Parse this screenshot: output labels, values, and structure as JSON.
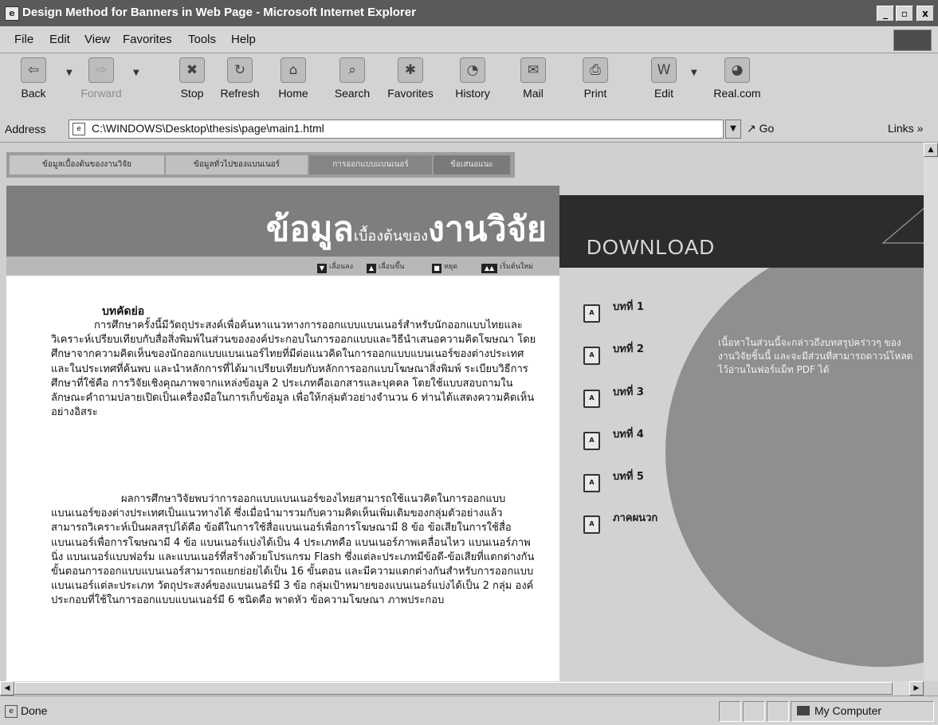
{
  "window": {
    "title": "Design Method for Banners in Web Page - Microsoft Internet Explorer",
    "controls": [
      "_",
      "▫",
      "x"
    ]
  },
  "menu": [
    "File",
    "Edit",
    "View",
    "Favorites",
    "Tools",
    "Help"
  ],
  "toolbar": {
    "buttons": [
      {
        "label": "Back",
        "icon": "back-arrow-icon",
        "glyph": "⇦",
        "enabled": true
      },
      {
        "label": "Forward",
        "icon": "forward-arrow-icon",
        "glyph": "⇨",
        "enabled": false
      },
      {
        "label": "Stop",
        "icon": "stop-icon",
        "glyph": "✖",
        "enabled": true
      },
      {
        "label": "Refresh",
        "icon": "refresh-icon",
        "glyph": "↻",
        "enabled": true
      },
      {
        "label": "Home",
        "icon": "home-icon",
        "glyph": "⌂",
        "enabled": true
      },
      {
        "label": "Search",
        "icon": "search-icon",
        "glyph": "⌕",
        "enabled": true
      },
      {
        "label": "Favorites",
        "icon": "favorites-icon",
        "glyph": "✱",
        "enabled": true
      },
      {
        "label": "History",
        "icon": "history-icon",
        "glyph": "◔",
        "enabled": true
      },
      {
        "label": "Mail",
        "icon": "mail-icon",
        "glyph": "✉",
        "enabled": true
      },
      {
        "label": "Print",
        "icon": "print-icon",
        "glyph": "⎙",
        "enabled": true
      },
      {
        "label": "Edit",
        "icon": "edit-icon",
        "glyph": "W",
        "enabled": true
      },
      {
        "label": "Real.com",
        "icon": "real-com-icon",
        "glyph": "◕",
        "enabled": true
      }
    ]
  },
  "address": {
    "label": "Address",
    "url": "C:\\WINDOWS\\Desktop\\thesis\\page\\main1.html",
    "go": "Go",
    "links": "Links »"
  },
  "page": {
    "nav_tabs": [
      "ข้อมูลเบื้องต้นของงานวิจัย",
      "ข้อมูลทั่วไปของแบนเนอร์",
      "การออกแบบแบนเนอร์",
      "ข้อเสนอแนะ"
    ],
    "banner": {
      "big": "ข้อมูล",
      "small": "เบื้องต้นของ",
      "big2": "งานวิจัย"
    },
    "controls": [
      "เลื่อนลง",
      "เลื่อนขึ้น",
      "หยุด",
      "เริ่มต้นใหม่"
    ],
    "abstract_heading": "บทคัดย่อ",
    "paragraph1": "การศึกษาครั้งนี้มีวัตถุประสงค์เพื่อค้นหาแนวทางการออกแบบแบนเนอร์สำหรับนักออกแบบไทยและวิเคราะห์เปรียบเทียบกับสื่อสิ่งพิมพ์ในส่วนขององค์ประกอบในการออกแบบและวิธีนำเสนอความคิดโฆษณา โดยศึกษาจากความคิดเห็นของนักออกแบบแบนเนอร์ไทยที่มีต่อแนวคิดในการออกแบบแบนเนอร์ของต่างประเทศและในประเทศที่ค้นพบ และนำหลักการที่ได้มาเปรียบเทียบกับหลักการออกแบบโฆษณาสิ่งพิมพ์ ระเบียบวิธีการศึกษาที่ใช้คือ การวิจัยเชิงคุณภาพจากแหล่งข้อมูล 2 ประเภทคือเอกสารและบุคคล โดยใช้แบบสอบถามในลักษณะคำถามปลายเปิดเป็นเครื่องมือในการเก็บข้อมูล เพื่อให้กลุ่มตัวอย่างจำนวน 6 ท่านได้แสดงความคิดเห็นอย่างอิสระ",
    "paragraph2": "ผลการศึกษาวิจัยพบว่าการออกแบบแบนเนอร์ของไทยสามารถใช้แนวคิดในการออกแบบแบนเนอร์ของต่างประเทศเป็นแนวทางได้ ซึ่งเมื่อนำมารวมกับความคิดเห็นเพิ่มเติมของกลุ่มตัวอย่างแล้วสามารถวิเคราะห์เป็นผลสรุปได้คือ ข้อดีในการใช้สื่อแบนเนอร์เพื่อการโฆษณามี 8 ข้อ ข้อเสียในการใช้สื่อแบนเนอร์เพื่อการโฆษณามี 4 ข้อ แบนเนอร์แบ่งได้เป็น 4 ประเภทคือ แบนเนอร์ภาพเคลื่อนไหว แบนเนอร์ภาพนิ่ง แบนเนอร์แบบฟอร์ม และแบนเนอร์ที่สร้างด้วยโปรแกรม Flash ซึ่งแต่ละประเภทมีข้อดี-ข้อเสียที่แตกต่างกัน ขั้นตอนการออกแบบแบนเนอร์สามารถแยกย่อยได้เป็น 16 ขั้นตอน และมีความแตกต่างกันสำหรับการออกแบบแบนเนอร์แต่ละประเภท วัตถุประสงค์ของแบนเนอร์มี 3 ข้อ กลุ่มเป้าหมายของแบนเนอร์แบ่งได้เป็น 2 กลุ่ม องค์ประกอบที่ใช้ในการออกแบบแบนเนอร์มี 6 ชนิดคือ พาดหัว ข้อความโฆษณา ภาพประกอบ",
    "download_title": "DOWNLOAD",
    "chapters": [
      "บทที่ 1",
      "บทที่ 2",
      "บทที่ 3",
      "บทที่ 4",
      "บทที่ 5",
      "ภาคผนวก"
    ],
    "download_description": "เนื้อหาในส่วนนี้จะกล่าวถึงบทสรุปคร่าวๆ ของงานวิจัยชิ้นนี้ และจะมีส่วนที่สามารถดาวน์โหลดไว้อ่านในฟอร์แม็ท PDF ได้"
  },
  "status": {
    "text": "Done",
    "zone": "My Computer"
  }
}
